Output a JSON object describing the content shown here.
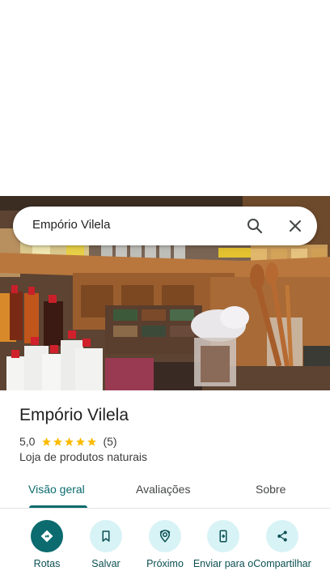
{
  "search": {
    "query": "Empório Vilela"
  },
  "place": {
    "name": "Empório Vilela",
    "rating": "5,0",
    "stars": 5,
    "review_count": "(5)",
    "category": "Loja de produtos naturais"
  },
  "tabs": [
    {
      "label": "Visão geral",
      "active": true
    },
    {
      "label": "Avaliações",
      "active": false
    },
    {
      "label": "Sobre",
      "active": false
    }
  ],
  "actions": [
    {
      "label": "Rotas",
      "icon": "directions-icon"
    },
    {
      "label": "Salvar",
      "icon": "bookmark-icon"
    },
    {
      "label": "Próximo",
      "icon": "nearby-icon"
    },
    {
      "label": "Enviar para o",
      "icon": "send-to-phone-icon"
    },
    {
      "label": "Compartilhar",
      "icon": "share-icon"
    }
  ],
  "colors": {
    "accent": "#0b6b6e",
    "star": "#fbbc04",
    "action_bg": "#d8f3f6"
  }
}
